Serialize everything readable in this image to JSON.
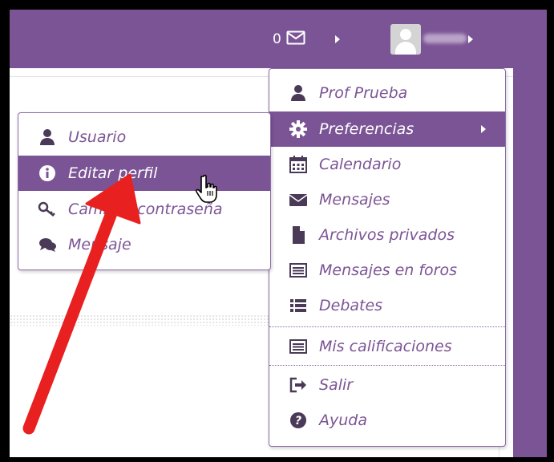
{
  "colors": {
    "brand": "#7b5495",
    "arrow": "#e8201f",
    "icon_dark": "#4a3a57"
  },
  "navbar": {
    "notif_count": "0",
    "icons": [
      "envelope-icon",
      "caret-right-icon",
      "user-avatar-icon"
    ]
  },
  "user_menu": {
    "items": [
      {
        "label": "Prof Prueba",
        "icon": "user-icon"
      },
      {
        "label": "Preferencias",
        "icon": "cog-icon",
        "active": true
      },
      {
        "label": "Calendario",
        "icon": "calendar-icon"
      },
      {
        "label": "Mensajes",
        "icon": "envelope-icon"
      },
      {
        "label": "Archivos privados",
        "icon": "file-icon"
      },
      {
        "label": "Mensajes en foros",
        "icon": "list-alt-icon"
      },
      {
        "label": "Debates",
        "icon": "list-icon"
      },
      {
        "label": "Mis calificaciones",
        "icon": "list-alt-icon"
      },
      {
        "label": "Salir",
        "icon": "sign-out-icon"
      },
      {
        "label": "Ayuda",
        "icon": "question-circle-icon"
      }
    ]
  },
  "sub_menu": {
    "items": [
      {
        "label": "Usuario",
        "icon": "user-icon"
      },
      {
        "label": "Editar perfil",
        "icon": "info-circle-icon",
        "active": true
      },
      {
        "label": "Cambiar contraseña",
        "icon": "key-icon"
      },
      {
        "label": "Mensaje",
        "icon": "comments-icon"
      }
    ]
  }
}
